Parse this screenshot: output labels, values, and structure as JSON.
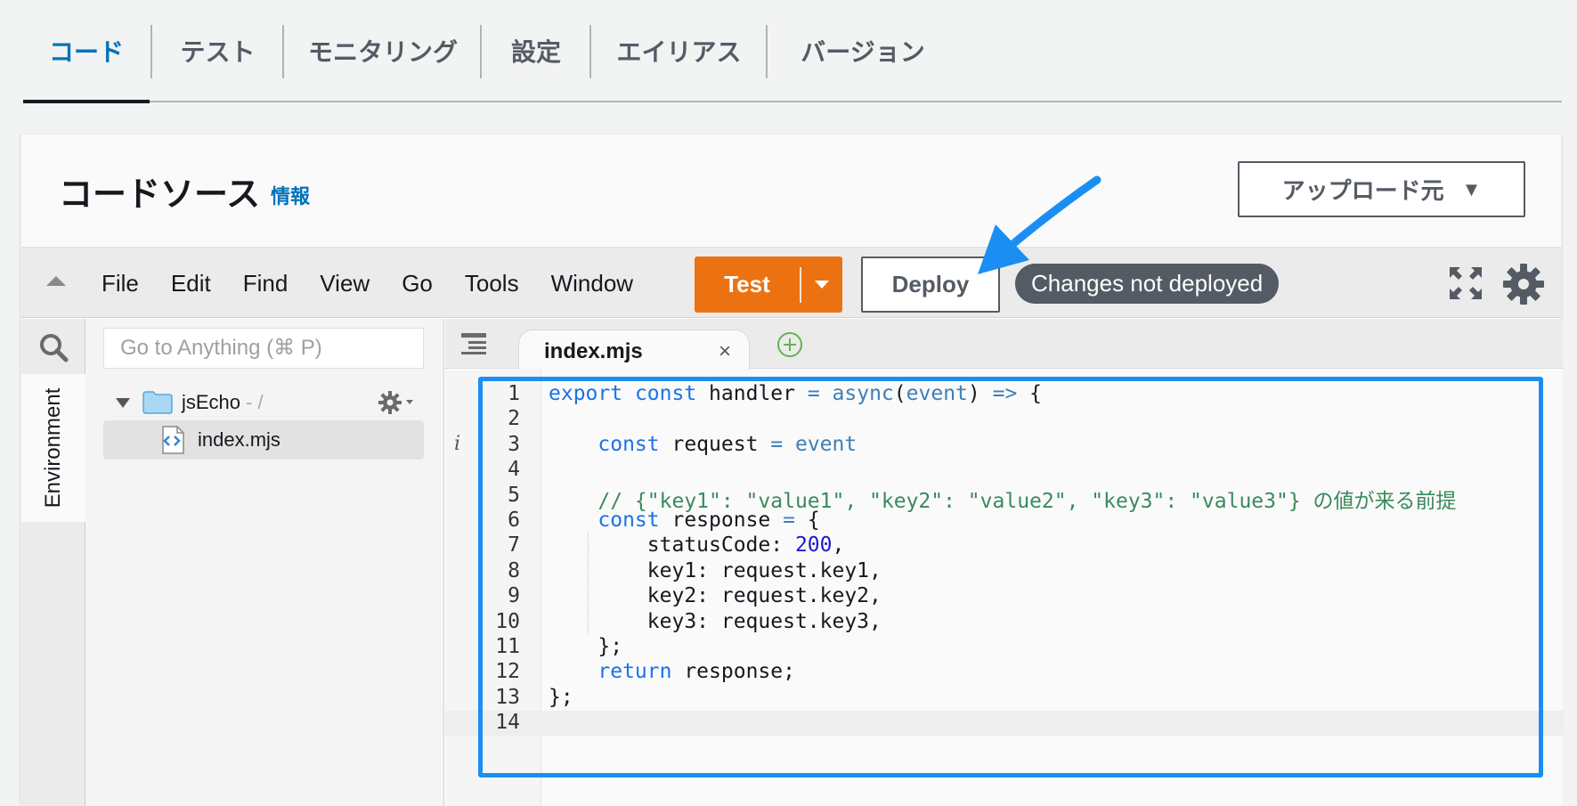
{
  "tabs": [
    {
      "label": "コード",
      "active": true
    },
    {
      "label": "テスト",
      "active": false
    },
    {
      "label": "モニタリング",
      "active": false
    },
    {
      "label": "設定",
      "active": false
    },
    {
      "label": "エイリアス",
      "active": false
    },
    {
      "label": "バージョン",
      "active": false
    }
  ],
  "panel": {
    "title": "コードソース",
    "info_link": "情報",
    "upload_button": "アップロード元"
  },
  "toolbar": {
    "menu": [
      "File",
      "Edit",
      "Find",
      "View",
      "Go",
      "Tools",
      "Window"
    ],
    "test_label": "Test",
    "deploy_label": "Deploy",
    "status": "Changes not deployed"
  },
  "sidebar": {
    "environment_label": "Environment",
    "search_placeholder": "Go to Anything (⌘ P)",
    "root_folder": "jsEcho",
    "root_suffix": "- /",
    "file": "index.mjs"
  },
  "editor": {
    "tab_name": "index.mjs",
    "close_glyph": "×",
    "lines": [
      "export const handler = async(event) => {",
      "",
      "    const request = event",
      "",
      "    // {\"key1\": \"value1\", \"key2\": \"value2\", \"key3\": \"value3\"} の値が来る前提",
      "    const response = {",
      "        statusCode: 200,",
      "        key1: request.key1,",
      "        key2: request.key2,",
      "        key3: request.key3,",
      "    };",
      "    return response;",
      "};",
      ""
    ],
    "current_line": 14,
    "info_marker": "i"
  },
  "colors": {
    "accent": "#0073bb",
    "test_button": "#ec7211",
    "highlight": "#1a8ef2",
    "status_pill": "#545b64"
  }
}
